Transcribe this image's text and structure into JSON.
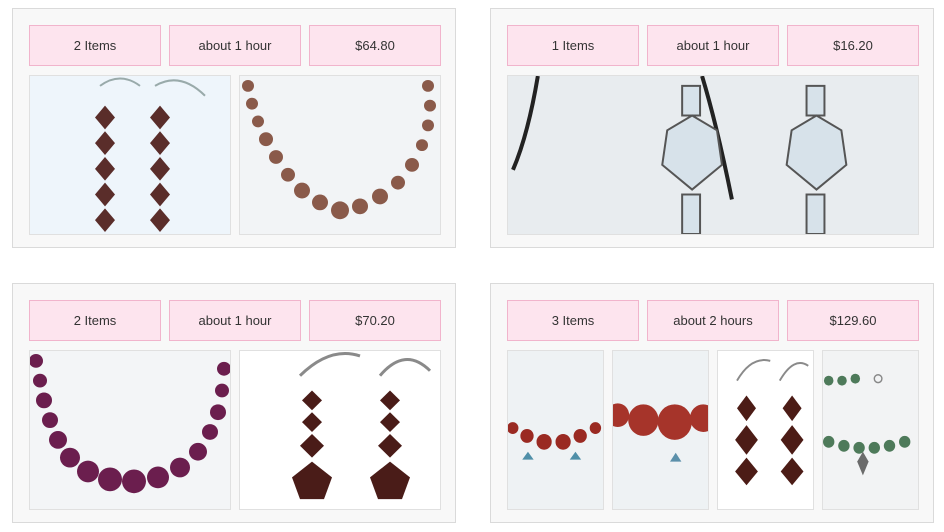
{
  "orders": [
    {
      "items": "2 Items",
      "time": "about 1 hour",
      "price": "$64.80",
      "photos": [
        "purple-bicone-earrings",
        "jasper-bead-bracelet"
      ]
    },
    {
      "items": "1 Items",
      "time": "about 1 hour",
      "price": "$16.20",
      "photos": [
        "clear-crystal-earrings"
      ]
    },
    {
      "items": "2 Items",
      "time": "about 1 hour",
      "price": "$70.20",
      "photos": [
        "amethyst-crystal-necklace",
        "brown-crystal-drop-earrings"
      ]
    },
    {
      "items": "3 Items",
      "time": "about 2 hours",
      "price": "$129.60",
      "photos": [
        "red-jasper-charm-bracelet",
        "red-jasper-bead-closeup",
        "brown-crystal-earrings",
        "green-jade-leaf-bracelet"
      ]
    }
  ],
  "colors": {
    "pill_bg": "#fde4ee",
    "pill_border": "#f1b4cc",
    "card_bg": "#f8f8f8"
  }
}
